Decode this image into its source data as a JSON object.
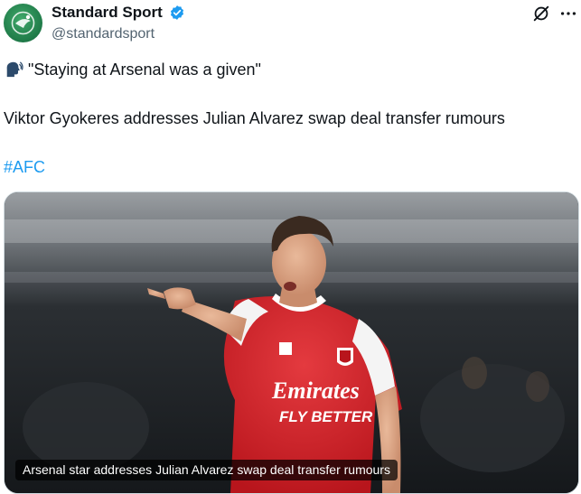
{
  "author": {
    "display_name": "Standard Sport",
    "handle": "@standardsport",
    "verified": true,
    "avatar_icon": "standard-sport-logo",
    "verified_color": "#1d9bf0"
  },
  "actions": {
    "grok_icon": "grok-icon",
    "more_icon": "more-icon"
  },
  "post": {
    "emoji": "🗣️",
    "quote": "\"Staying at Arsenal was a given\"",
    "headline": "Viktor Gyokeres addresses Julian Alvarez swap deal transfer rumours",
    "hashtag": "#AFC",
    "hashtag_color": "#1d9bf0"
  },
  "media": {
    "caption": "Arsenal star addresses Julian Alvarez swap deal transfer rumours",
    "shirt_sponsor_line1": "Emirates",
    "shirt_sponsor_line2": "FLY BETTER"
  }
}
